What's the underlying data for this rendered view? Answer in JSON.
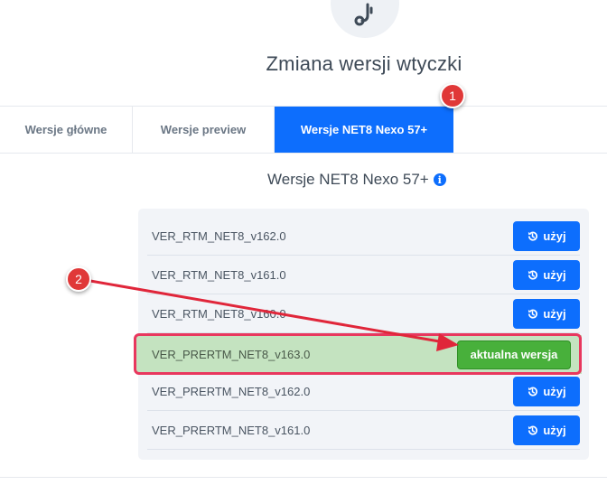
{
  "header": {
    "title": "Zmiana wersji wtyczki",
    "icon": "plug-icon"
  },
  "tabs": [
    {
      "label": "Wersje główne",
      "active": false
    },
    {
      "label": "Wersje preview",
      "active": false
    },
    {
      "label": "Wersje NET8 Nexo 57+",
      "active": true
    }
  ],
  "section": {
    "title": "Wersje NET8 Nexo 57+",
    "info_icon": "info-icon"
  },
  "versions": [
    {
      "name": "VER_RTM_NET8_v162.0",
      "action": "użyj",
      "current": false
    },
    {
      "name": "VER_RTM_NET8_v161.0",
      "action": "użyj",
      "current": false
    },
    {
      "name": "VER_RTM_NET8_v160.0",
      "action": "użyj",
      "current": false
    },
    {
      "name": "VER_PRERTM_NET8_v163.0",
      "action": "aktualna wersja",
      "current": true
    },
    {
      "name": "VER_PRERTM_NET8_v162.0",
      "action": "użyj",
      "current": false
    },
    {
      "name": "VER_PRERTM_NET8_v161.0",
      "action": "użyj",
      "current": false
    }
  ],
  "annotations": {
    "badge_1": "1",
    "badge_2": "2"
  },
  "colors": {
    "primary": "#0d6efd",
    "success": "#48b03b",
    "current_row": "#c4e3c0",
    "annotation": "#e03838",
    "highlight": "#e8375e"
  }
}
